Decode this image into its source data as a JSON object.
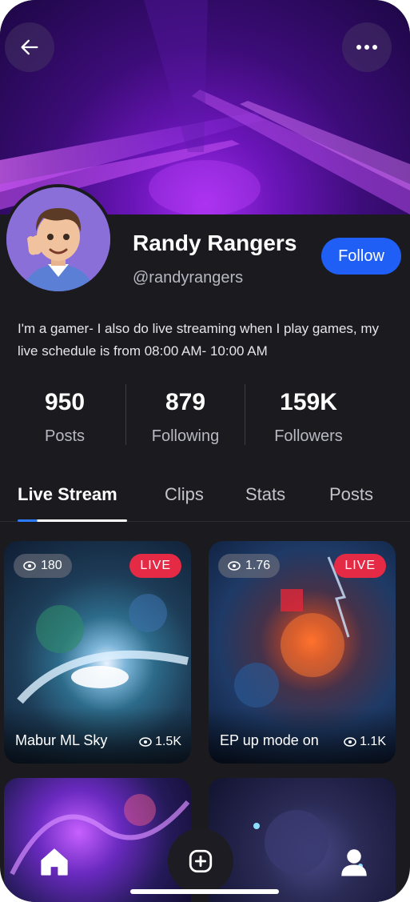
{
  "profile": {
    "name": "Randy Rangers",
    "handle": "@randyrangers",
    "follow_label": "Follow",
    "bio": "I'm a gamer- I also do live streaming when I play games, my live schedule is from 08:00 AM- 10:00 AM"
  },
  "stats": [
    {
      "value": "950",
      "label": "Posts"
    },
    {
      "value": "879",
      "label": "Following"
    },
    {
      "value": "159K",
      "label": "Followers"
    }
  ],
  "tabs": [
    {
      "label": "Live Stream",
      "active": true
    },
    {
      "label": "Clips",
      "active": false
    },
    {
      "label": "Stats",
      "active": false
    },
    {
      "label": "Posts",
      "active": false
    }
  ],
  "streams": [
    {
      "viewers": "180",
      "badge": "LIVE",
      "title": "Mabur ML Sky",
      "views": "1.5K"
    },
    {
      "viewers": "1.76",
      "badge": "LIVE",
      "title": "EP up mode on",
      "views": "1.1K"
    }
  ],
  "header": {
    "back_icon": "arrow-left-icon",
    "more_icon": "more-horizontal-icon"
  },
  "nav": {
    "items": [
      "home-icon",
      "add-icon",
      "profile-icon"
    ]
  },
  "colors": {
    "accent": "#1f5ff5",
    "live": "#e52a45",
    "background": "#1a1a1f"
  }
}
